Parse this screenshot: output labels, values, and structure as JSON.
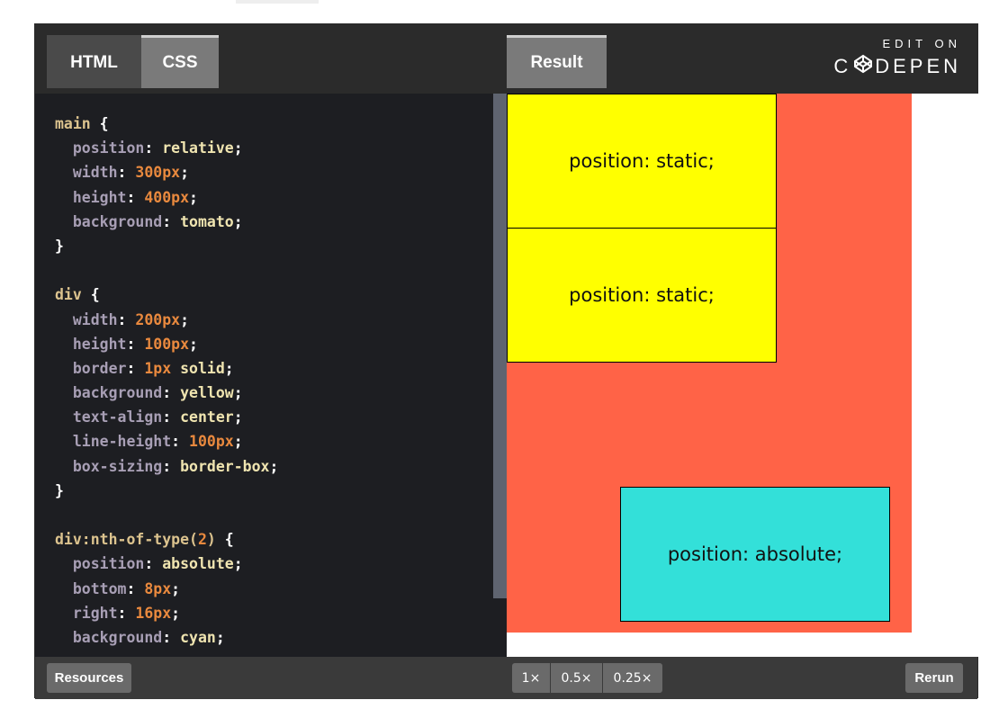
{
  "tabs": {
    "html": "HTML",
    "css": "CSS",
    "result": "Result"
  },
  "brand": {
    "edit_on": "EDIT ON",
    "codepen_left": "C",
    "codepen_right": "DEPEN"
  },
  "code_lines": [
    [
      {
        "t": "sel",
        "v": "main"
      },
      {
        "t": "brace",
        "v": " {"
      }
    ],
    [
      {
        "t": "prop",
        "v": "  position"
      },
      {
        "t": "colon",
        "v": ": "
      },
      {
        "t": "val",
        "v": "relative"
      },
      {
        "t": "colon",
        "v": ";"
      }
    ],
    [
      {
        "t": "prop",
        "v": "  width"
      },
      {
        "t": "colon",
        "v": ": "
      },
      {
        "t": "num",
        "v": "300px"
      },
      {
        "t": "colon",
        "v": ";"
      }
    ],
    [
      {
        "t": "prop",
        "v": "  height"
      },
      {
        "t": "colon",
        "v": ": "
      },
      {
        "t": "num",
        "v": "400px"
      },
      {
        "t": "colon",
        "v": ";"
      }
    ],
    [
      {
        "t": "prop",
        "v": "  background"
      },
      {
        "t": "colon",
        "v": ": "
      },
      {
        "t": "val",
        "v": "tomato"
      },
      {
        "t": "colon",
        "v": ";"
      }
    ],
    [
      {
        "t": "brace",
        "v": "}"
      }
    ],
    [],
    [
      {
        "t": "sel",
        "v": "div"
      },
      {
        "t": "brace",
        "v": " {"
      }
    ],
    [
      {
        "t": "prop",
        "v": "  width"
      },
      {
        "t": "colon",
        "v": ": "
      },
      {
        "t": "num",
        "v": "200px"
      },
      {
        "t": "colon",
        "v": ";"
      }
    ],
    [
      {
        "t": "prop",
        "v": "  height"
      },
      {
        "t": "colon",
        "v": ": "
      },
      {
        "t": "num",
        "v": "100px"
      },
      {
        "t": "colon",
        "v": ";"
      }
    ],
    [
      {
        "t": "prop",
        "v": "  border"
      },
      {
        "t": "colon",
        "v": ": "
      },
      {
        "t": "num",
        "v": "1px"
      },
      {
        "t": "val",
        "v": " solid"
      },
      {
        "t": "colon",
        "v": ";"
      }
    ],
    [
      {
        "t": "prop",
        "v": "  background"
      },
      {
        "t": "colon",
        "v": ": "
      },
      {
        "t": "val",
        "v": "yellow"
      },
      {
        "t": "colon",
        "v": ";"
      }
    ],
    [
      {
        "t": "prop",
        "v": "  text-align"
      },
      {
        "t": "colon",
        "v": ": "
      },
      {
        "t": "val",
        "v": "center"
      },
      {
        "t": "colon",
        "v": ";"
      }
    ],
    [
      {
        "t": "prop",
        "v": "  line-height"
      },
      {
        "t": "colon",
        "v": ": "
      },
      {
        "t": "num",
        "v": "100px"
      },
      {
        "t": "colon",
        "v": ";"
      }
    ],
    [
      {
        "t": "prop",
        "v": "  box-sizing"
      },
      {
        "t": "colon",
        "v": ": "
      },
      {
        "t": "val",
        "v": "border-box"
      },
      {
        "t": "colon",
        "v": ";"
      }
    ],
    [
      {
        "t": "brace",
        "v": "}"
      }
    ],
    [],
    [
      {
        "t": "sel",
        "v": "div:nth-of-type("
      },
      {
        "t": "num",
        "v": "2"
      },
      {
        "t": "sel",
        "v": ")"
      },
      {
        "t": "brace",
        "v": " {"
      }
    ],
    [
      {
        "t": "prop",
        "v": "  position"
      },
      {
        "t": "colon",
        "v": ": "
      },
      {
        "t": "val",
        "v": "absolute"
      },
      {
        "t": "colon",
        "v": ";"
      }
    ],
    [
      {
        "t": "prop",
        "v": "  bottom"
      },
      {
        "t": "colon",
        "v": ": "
      },
      {
        "t": "num",
        "v": "8px"
      },
      {
        "t": "colon",
        "v": ";"
      }
    ],
    [
      {
        "t": "prop",
        "v": "  right"
      },
      {
        "t": "colon",
        "v": ": "
      },
      {
        "t": "num",
        "v": "16px"
      },
      {
        "t": "colon",
        "v": ";"
      }
    ],
    [
      {
        "t": "prop",
        "v": "  background"
      },
      {
        "t": "colon",
        "v": ": "
      },
      {
        "t": "val",
        "v": "cyan"
      },
      {
        "t": "colon",
        "v": ";"
      }
    ]
  ],
  "result": {
    "div1": "position: static;",
    "div2": "position: static;",
    "div3": "position: absolute;"
  },
  "footer": {
    "resources": "Resources",
    "zoom": [
      "1×",
      "0.5×",
      "0.25×"
    ],
    "rerun": "Rerun"
  },
  "colors": {
    "main_bg": "#ff6347",
    "yellow_box": "#ffff00",
    "cyan_box": "#33e0d9",
    "editor_bg": "#1d1e22",
    "header_bg": "#2b2b2b"
  },
  "icons": {
    "brand_logo": "codepen-cube-icon"
  }
}
